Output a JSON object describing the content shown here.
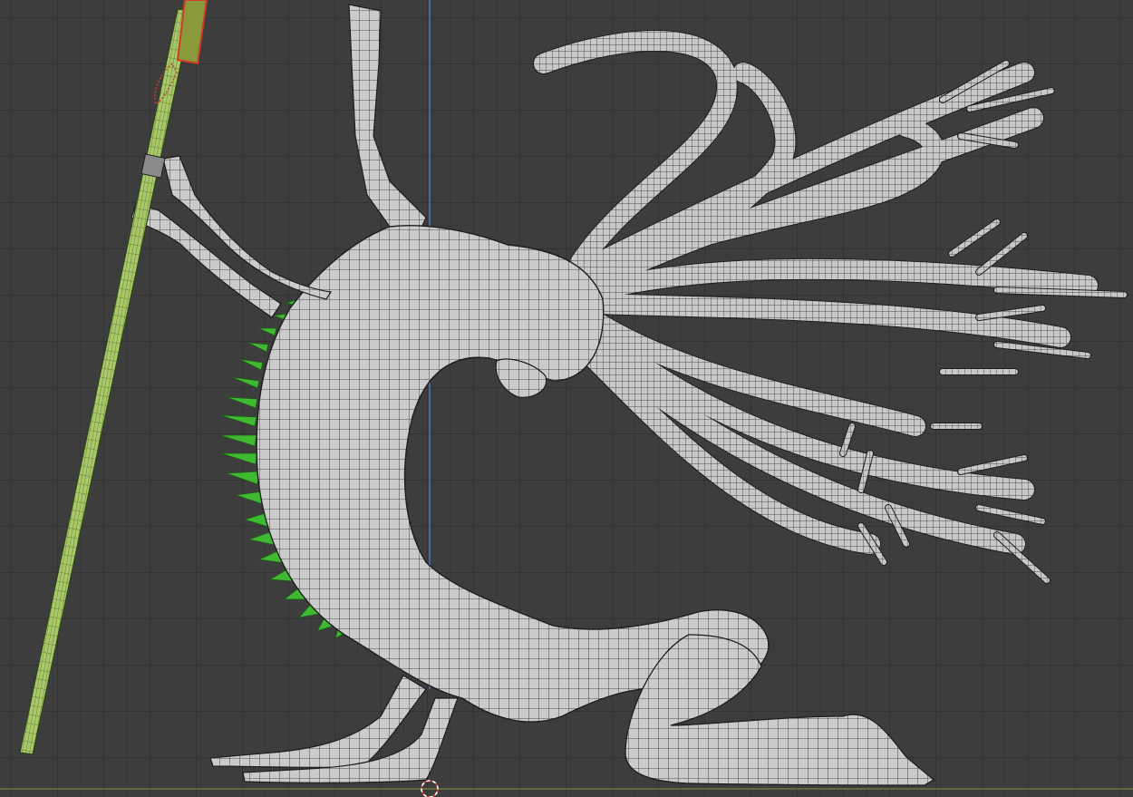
{
  "viewport": {
    "type": "blender-3d-viewport",
    "shading": "solid-wireframe",
    "view": "orthographic-side",
    "colors": {
      "background": "#3d3d3d",
      "grid_line": "#333333",
      "z_axis": "#4f7ed6",
      "floor_line": "#7a9a3a",
      "mesh_fill": "#c9c9c9",
      "mesh_wire": "#1e1e1e",
      "spikes": "#3fb832",
      "staff": "#a9c86a",
      "staff_wire": "#4c6a25",
      "selection": "#d23a2a",
      "cursor": "#d23a2a"
    }
  },
  "objects": [
    {
      "name": "creature-body",
      "icon": "mesh"
    },
    {
      "name": "tentacles",
      "icon": "mesh"
    },
    {
      "name": "back-spikes",
      "icon": "mesh"
    },
    {
      "name": "staff",
      "icon": "mesh"
    }
  ],
  "cursor": {
    "icon": "3d-cursor-icon"
  }
}
